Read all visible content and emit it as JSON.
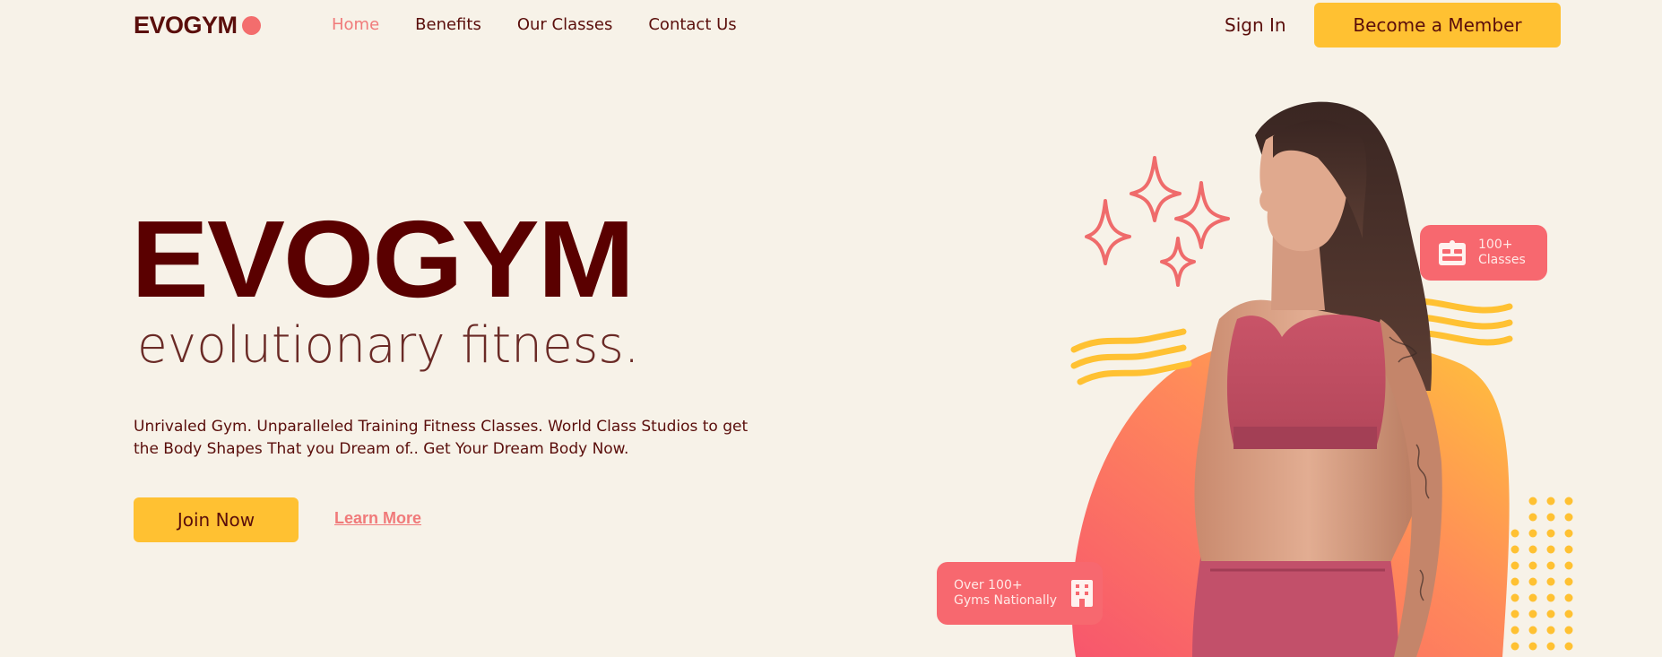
{
  "brand": {
    "name": "EVOGYM",
    "accent": "#f36d6d"
  },
  "nav": {
    "items": [
      {
        "label": "Home",
        "active": true
      },
      {
        "label": "Benefits",
        "active": false
      },
      {
        "label": "Our Classes",
        "active": false
      },
      {
        "label": "Contact Us",
        "active": false
      }
    ],
    "sign_in": "Sign In",
    "cta": "Become a Member"
  },
  "hero": {
    "title": "EVOGYM",
    "subtitle": "evolutionary fitness.",
    "description": "Unrivaled Gym. Unparalleled Training Fitness Classes. World Class Studios to get the Body Shapes That you Dream of.. Get Your Dream Body Now.",
    "primary_cta": "Join Now",
    "secondary_cta": "Learn More"
  },
  "badges": {
    "classes": {
      "line1": "100+",
      "line2": "Classes",
      "icon": "id-card-icon"
    },
    "gyms": {
      "line1": "Over 100+",
      "line2": "Gyms Nationally",
      "icon": "building-icon"
    }
  },
  "colors": {
    "background": "#f7f2e8",
    "primary_text": "#5a0e0b",
    "button_yellow": "#ffc132",
    "link_pink": "#f07a7a",
    "badge_red": "#f7686f"
  }
}
